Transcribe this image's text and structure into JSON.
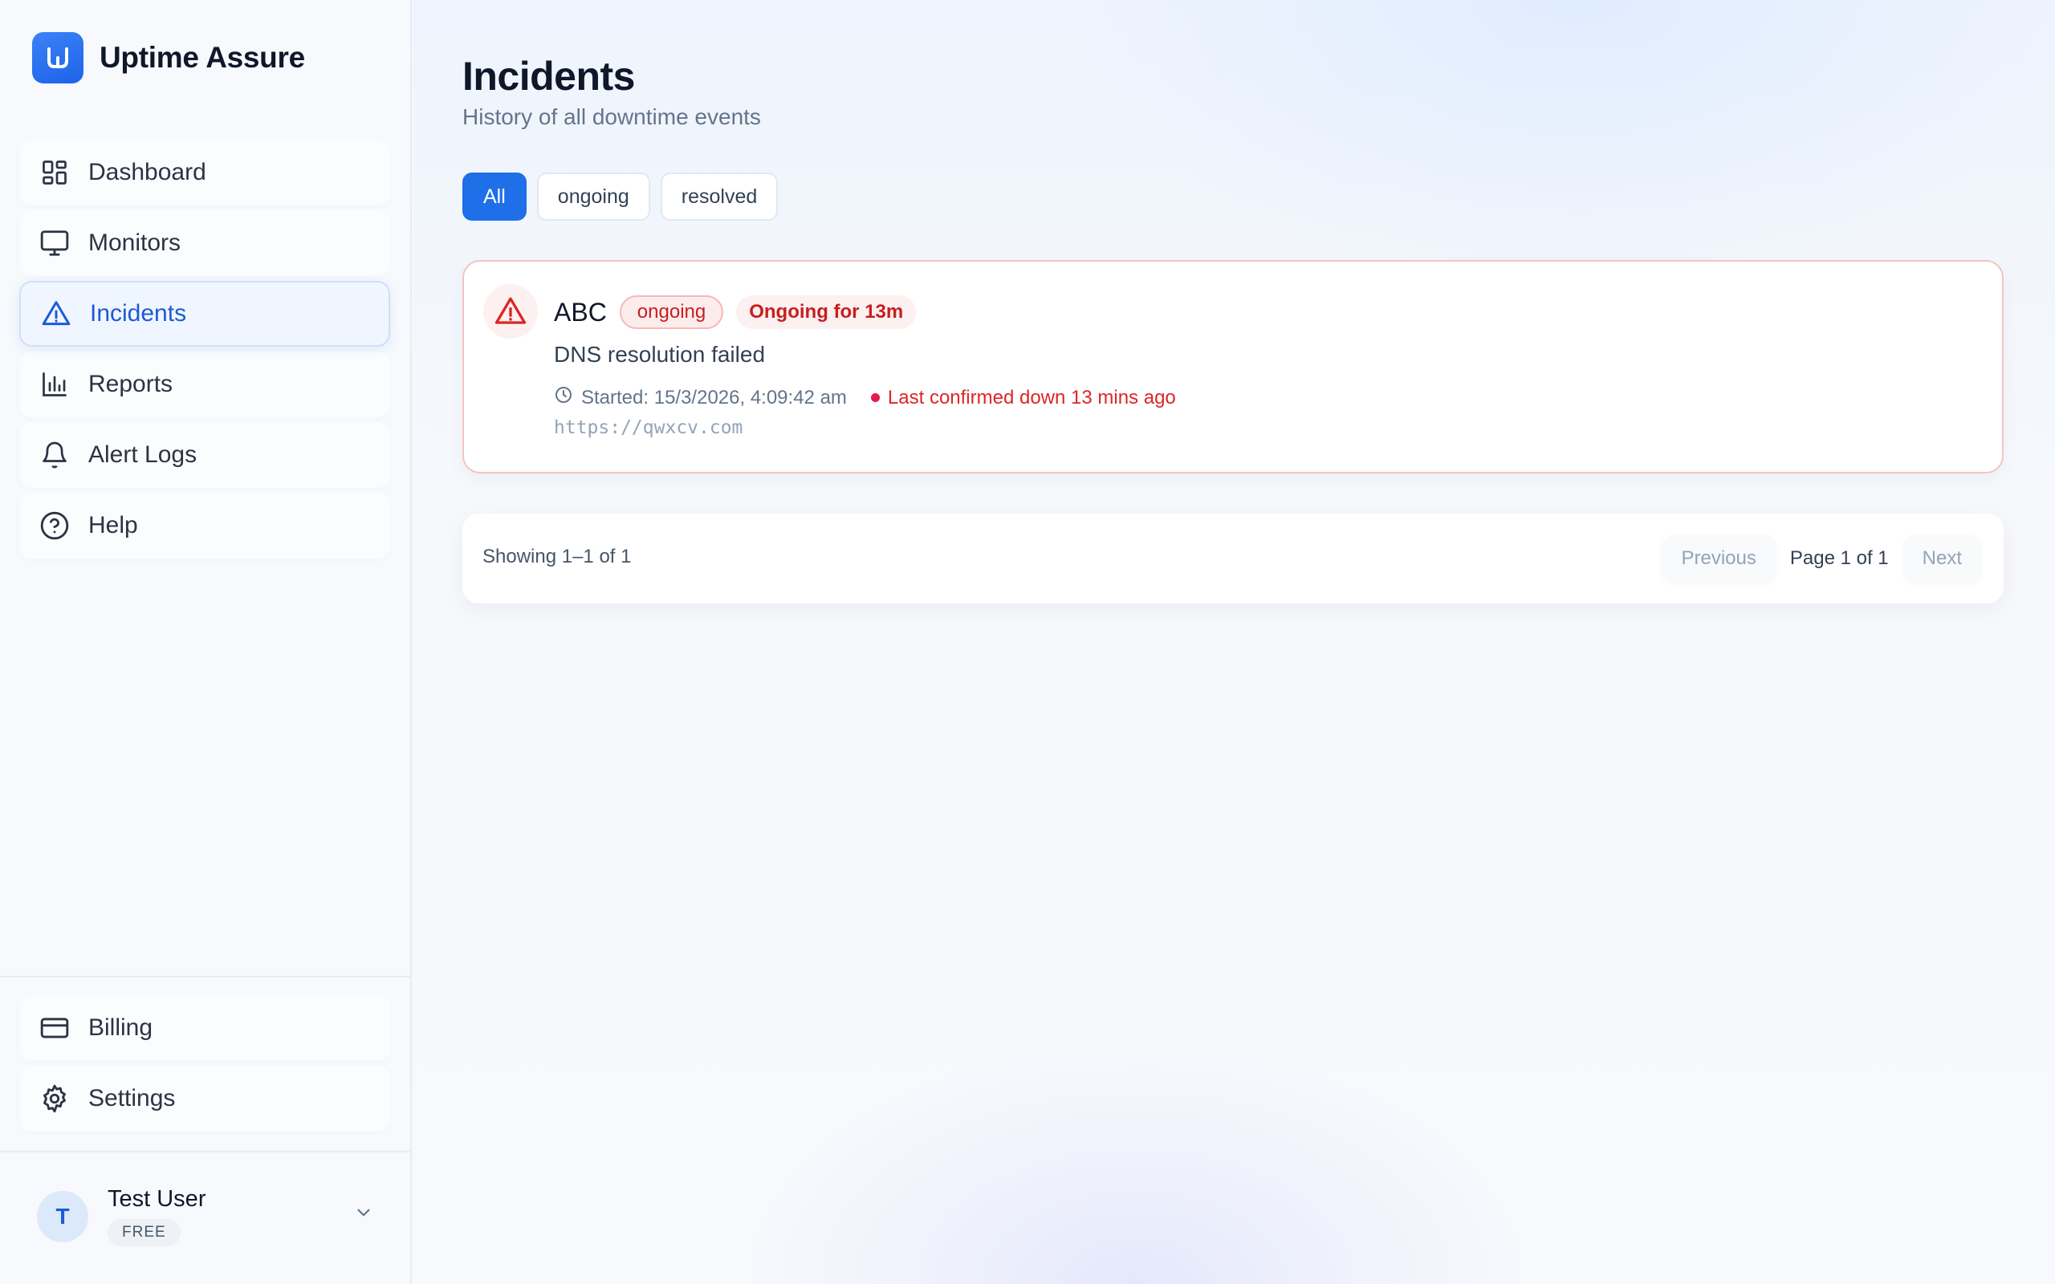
{
  "app": {
    "name": "Uptime Assure",
    "accent": "#1f6fe8",
    "danger": "#dc2626"
  },
  "sidebar": {
    "items": [
      {
        "label": "Dashboard",
        "icon": "grid-icon",
        "active": false
      },
      {
        "label": "Monitors",
        "icon": "monitor-icon",
        "active": false
      },
      {
        "label": "Incidents",
        "icon": "warning-icon",
        "active": true
      },
      {
        "label": "Reports",
        "icon": "bar-chart-icon",
        "active": false
      },
      {
        "label": "Alert Logs",
        "icon": "bell-icon",
        "active": false
      },
      {
        "label": "Help",
        "icon": "help-circle-icon",
        "active": false
      }
    ],
    "bottom_items": [
      {
        "label": "Billing",
        "icon": "credit-card-icon"
      },
      {
        "label": "Settings",
        "icon": "gear-icon"
      }
    ],
    "user": {
      "initial": "T",
      "name": "Test User",
      "plan": "FREE"
    }
  },
  "page": {
    "title": "Incidents",
    "subtitle": "History of all downtime events",
    "filters": [
      {
        "label": "All",
        "active": true
      },
      {
        "label": "ongoing",
        "active": false
      },
      {
        "label": "resolved",
        "active": false
      }
    ]
  },
  "incidents": [
    {
      "name": "ABC",
      "status": "ongoing",
      "duration": "Ongoing for 13m",
      "message": "DNS resolution failed",
      "started": "Started: 15/3/2026, 4:09:42 am",
      "last_confirmed": "Last confirmed down 13 mins ago",
      "url": "https://qwxcv.com"
    }
  ],
  "pagination": {
    "showing": "Showing 1–1 of 1",
    "previous": "Previous",
    "page_label": "Page 1 of 1",
    "next": "Next"
  }
}
